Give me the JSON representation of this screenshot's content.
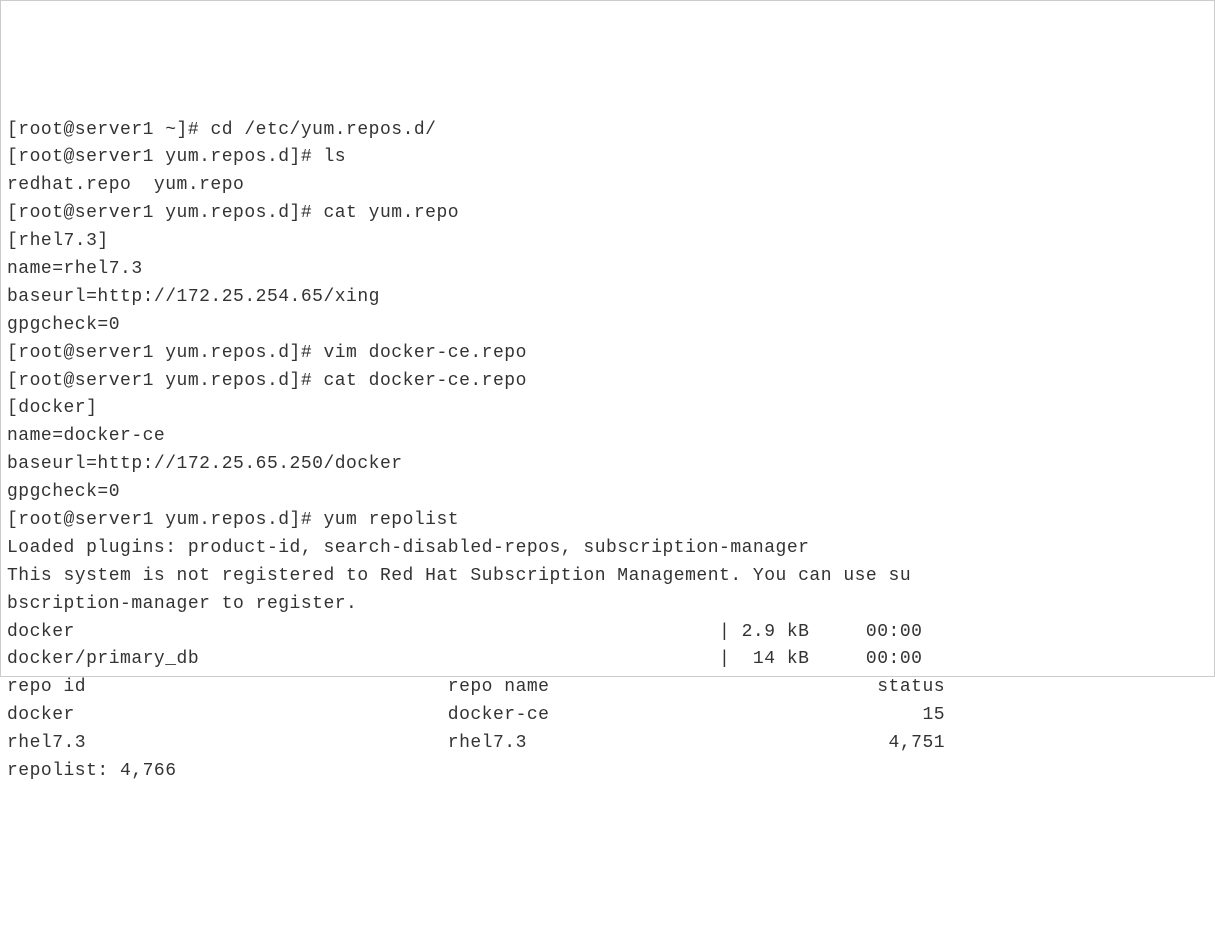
{
  "prompts": {
    "home": "[root@server1 ~]# ",
    "repo_dir": "[root@server1 yum.repos.d]# "
  },
  "commands": {
    "cd": "cd /etc/yum.repos.d/",
    "ls": "ls",
    "cat_yum": "cat yum.repo",
    "vim_docker": "vim docker-ce.repo",
    "cat_docker": "cat docker-ce.repo",
    "yum_repolist": "yum repolist"
  },
  "ls_output": "redhat.repo  yum.repo",
  "yum_repo_file": {
    "section": "[rhel7.3]",
    "name": "name=rhel7.3",
    "baseurl": "baseurl=http://172.25.254.65/xing",
    "gpgcheck": "gpgcheck=0"
  },
  "docker_repo_file": {
    "section": "[docker]",
    "name": "name=docker-ce",
    "baseurl": "baseurl=http://172.25.65.250/docker",
    "gpgcheck": "gpgcheck=0"
  },
  "repolist_output": {
    "loaded_plugins": "Loaded plugins: product-id, search-disabled-repos, subscription-manager",
    "not_registered_1": "This system is not registered to Red Hat Subscription Management. You can use su",
    "not_registered_2": "bscription-manager to register.",
    "docker_dl": "docker                                                         | 2.9 kB     00:00",
    "docker_primary": "docker/primary_db                                              |  14 kB     00:00",
    "header": "repo id                                repo name                             status",
    "row_docker": "docker                                 docker-ce                                 15",
    "row_rhel": "rhel7.3                                rhel7.3                                4,751",
    "total": "repolist: 4,766"
  }
}
